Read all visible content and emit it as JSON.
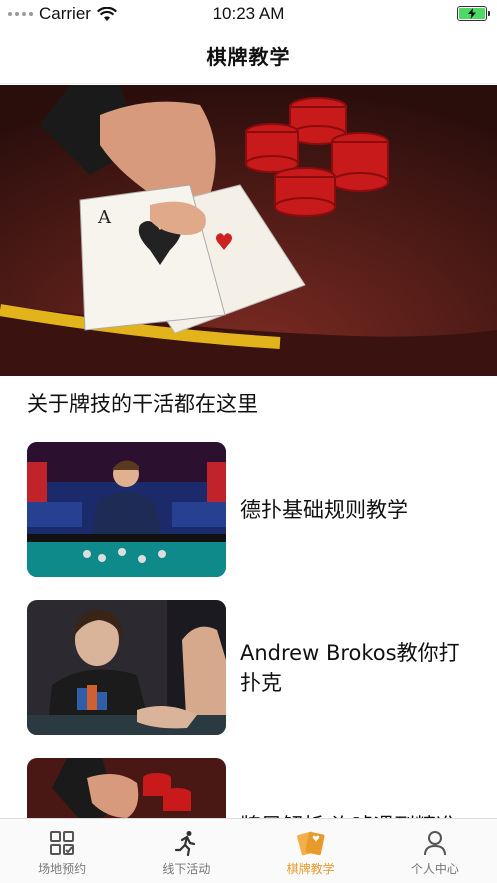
{
  "status_bar": {
    "carrier": "Carrier",
    "time": "10:23 AM",
    "battery_color": "#4cd964"
  },
  "nav": {
    "title": "棋牌教学"
  },
  "hero": {
    "image_icon": "poker-cards-chips-photo"
  },
  "section": {
    "title": "关于牌技的干活都在这里"
  },
  "articles": [
    {
      "title": "德扑基础规则教学",
      "thumb_icon": "poker-tournament-photo"
    },
    {
      "title": "Andrew Brokos教你打扑克",
      "thumb_icon": "poker-player-photo"
    },
    {
      "title": "牌局解析:诈唬遇到精准",
      "thumb_icon": "poker-cards-chips-photo"
    }
  ],
  "tab_bar": {
    "accent_color": "#e89a2c",
    "tabs": [
      {
        "label": "场地预约",
        "icon": "grid-check-icon",
        "active": false
      },
      {
        "label": "线下活动",
        "icon": "running-icon",
        "active": false
      },
      {
        "label": "棋牌教学",
        "icon": "cards-icon",
        "active": true
      },
      {
        "label": "个人中心",
        "icon": "person-icon",
        "active": false
      }
    ]
  }
}
